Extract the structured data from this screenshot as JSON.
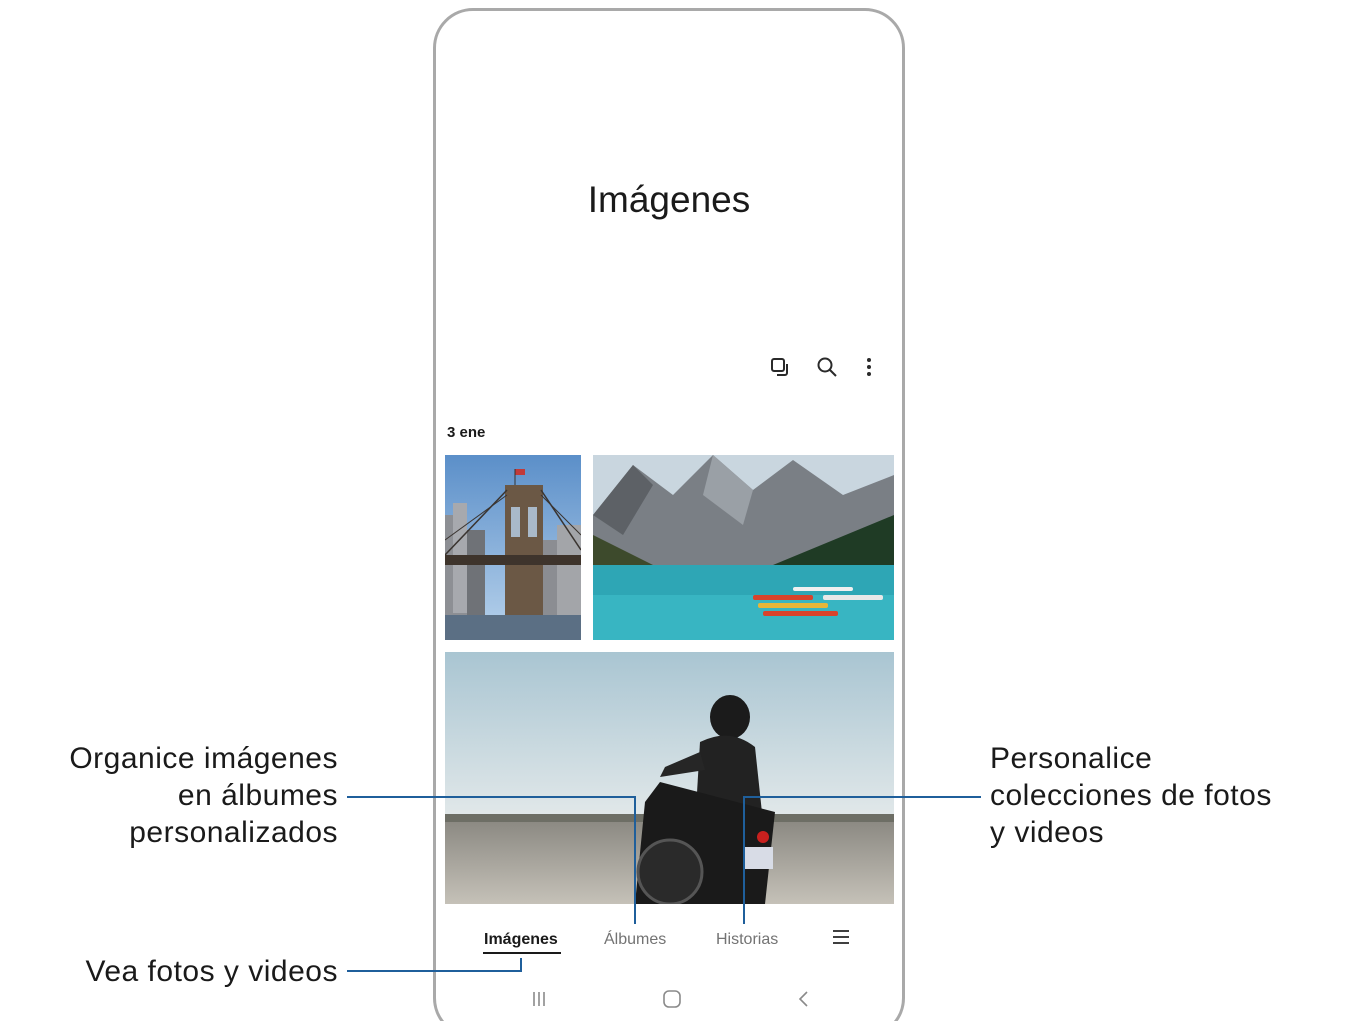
{
  "app": {
    "title": "Imágenes"
  },
  "toolbar": {
    "icons": [
      "select-icon",
      "search-icon",
      "more-options-icon"
    ]
  },
  "gallery": {
    "date_header": "3 ene",
    "photos": [
      "bridge-photo",
      "mountain-lake-photo",
      "motorcycle-rider-photo"
    ]
  },
  "tabs": [
    {
      "label": "Imágenes",
      "active": true
    },
    {
      "label": "Álbumes",
      "active": false
    },
    {
      "label": "Historias",
      "active": false
    }
  ],
  "navigation": {
    "buttons": [
      "recent-apps-icon",
      "home-icon",
      "back-icon"
    ]
  },
  "callouts": {
    "albums": [
      "Organice imágenes",
      "en álbumes",
      "personalizados"
    ],
    "pictures": [
      "Vea fotos y videos"
    ],
    "stories": [
      "Personalice",
      "colecciones de fotos",
      "y videos"
    ]
  },
  "colors": {
    "leader_line": "#1f5f9b",
    "frame": "#a9a9a9",
    "active_tab": "#1a1a1a",
    "inactive_tab": "#737373"
  }
}
